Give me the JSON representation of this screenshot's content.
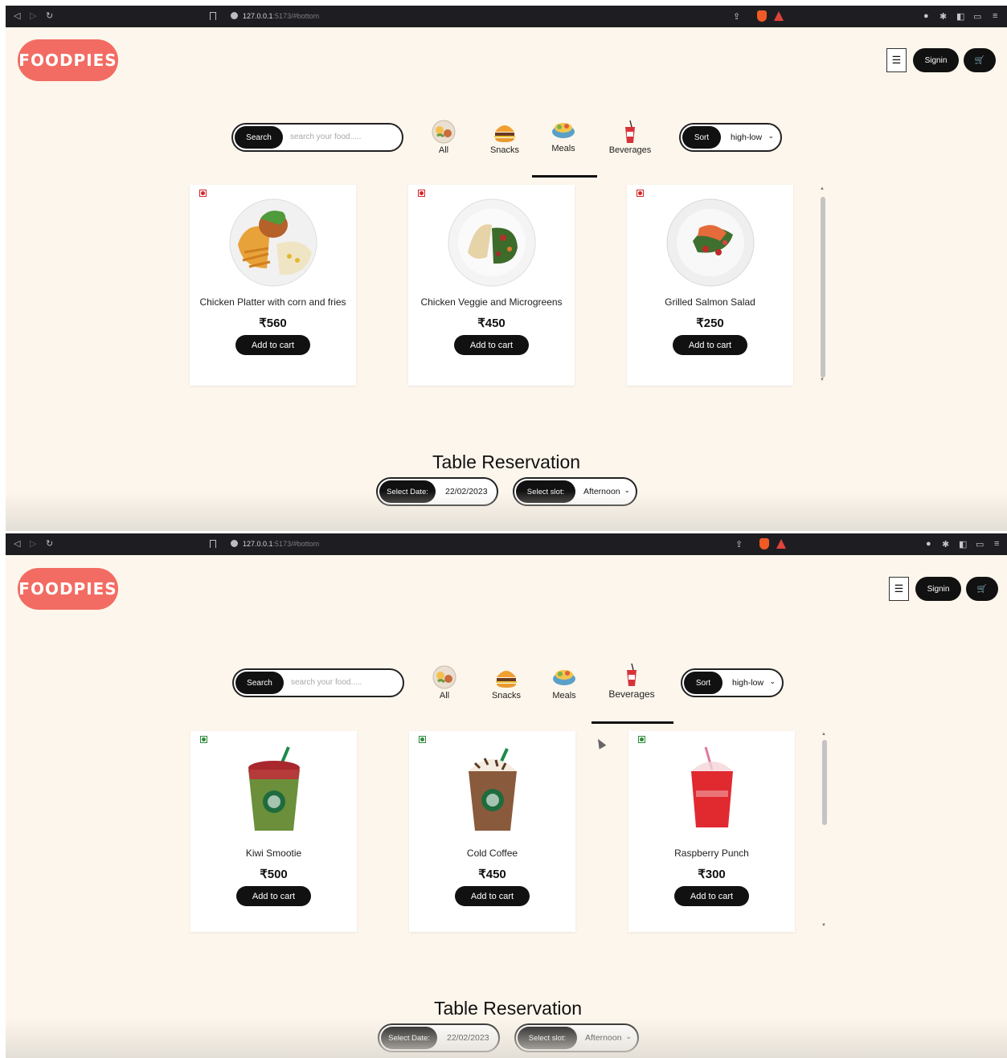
{
  "browser": {
    "url_host": "127.0.0.1",
    "url_rest": ":5173/#bottom"
  },
  "header": {
    "logo_text": "FOODPIES",
    "menu_icon": "☰",
    "signin_label": "Signin",
    "cart_icon": "🛒"
  },
  "colors": {
    "brand": "#f26c63",
    "page_bg": "#fdf6ec",
    "button": "#111111",
    "veg_marker": "#2e8b3a",
    "nonveg_marker": "#d2272b"
  },
  "search": {
    "button_label": "Search",
    "placeholder": "search your food....."
  },
  "categories": [
    "All",
    "Snacks",
    "Meals",
    "Beverages"
  ],
  "sort": {
    "button_label": "Sort",
    "value": "high-low"
  },
  "screen1": {
    "active_category": "Meals",
    "items": [
      {
        "name": "Chicken Platter with corn and fries",
        "price": "₹560",
        "add_label": "Add to cart",
        "image_icon": "chicken-platter-icon"
      },
      {
        "name": "Chicken Veggie and Microgreens",
        "price": "₹450",
        "add_label": "Add to cart",
        "image_icon": "chicken-microgreens-icon"
      },
      {
        "name": "Grilled Salmon Salad",
        "price": "₹250",
        "add_label": "Add to cart",
        "image_icon": "salmon-salad-icon"
      }
    ]
  },
  "screen2": {
    "active_category": "Beverages",
    "items": [
      {
        "name": "Kiwi Smootie",
        "price": "₹500",
        "add_label": "Add to cart",
        "image_icon": "kiwi-smoothie-icon"
      },
      {
        "name": "Cold Coffee",
        "price": "₹450",
        "add_label": "Add to cart",
        "image_icon": "cold-coffee-icon"
      },
      {
        "name": "Raspberry Punch",
        "price": "₹300",
        "add_label": "Add to cart",
        "image_icon": "raspberry-punch-icon"
      }
    ]
  },
  "reservation": {
    "title": "Table Reservation",
    "date_button": "Select Date:",
    "date_value": "22/02/2023",
    "slot_button": "Select slot:",
    "slot_value": "Afternoon"
  }
}
